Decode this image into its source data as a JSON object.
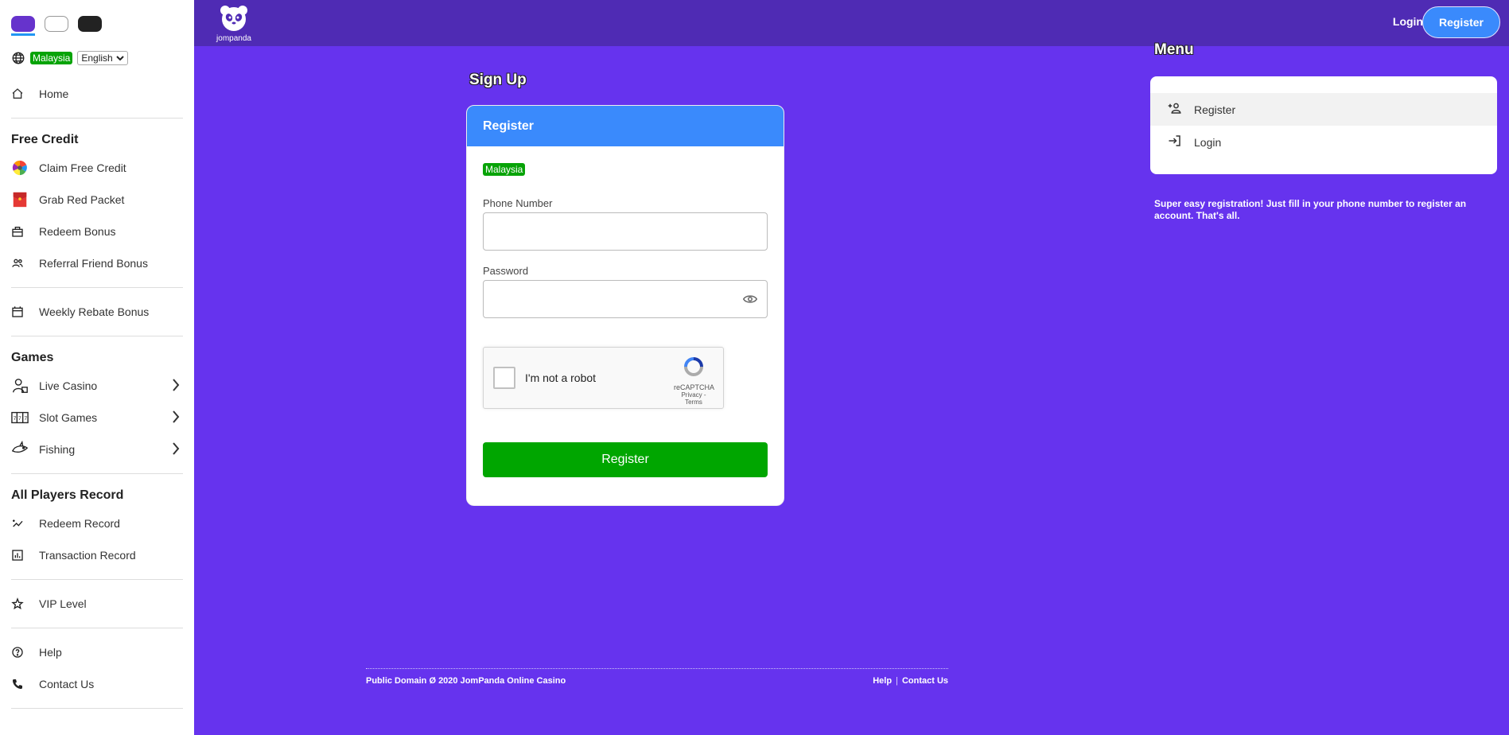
{
  "sidebar": {
    "themes": [
      {
        "name": "purple",
        "active": true
      },
      {
        "name": "white",
        "active": false
      },
      {
        "name": "dark",
        "active": false
      }
    ],
    "region_badge": "Malaysia",
    "language": "English",
    "home": "Home",
    "free_credit": {
      "title": "Free Credit",
      "items": [
        "Claim Free Credit",
        "Grab Red Packet",
        "Redeem Bonus",
        "Referral Friend Bonus"
      ]
    },
    "weekly_rebate": "Weekly Rebate Bonus",
    "games": {
      "title": "Games",
      "items": [
        "Live Casino",
        "Slot Games",
        "Fishing"
      ]
    },
    "records": {
      "title": "All Players Record",
      "items": [
        "Redeem Record",
        "Transaction Record"
      ]
    },
    "vip": "VIP Level",
    "help": "Help",
    "contact": "Contact Us"
  },
  "header": {
    "logo_text": "jompanda",
    "login": "Login",
    "register": "Register"
  },
  "signup": {
    "page_title": "Sign Up",
    "card_title": "Register",
    "region_badge": "Malaysia",
    "phone_label": "Phone Number",
    "phone_value": "",
    "password_label": "Password",
    "password_value": "",
    "recaptcha_label": "I'm not a robot",
    "recaptcha_brand": "reCAPTCHA",
    "recaptcha_links": "Privacy - Terms",
    "submit": "Register"
  },
  "menu": {
    "title": "Menu",
    "items": [
      "Register",
      "Login"
    ],
    "active": "Register",
    "promo": "Super easy registration! Just fill in your phone number to register an account. That's all."
  },
  "footer": {
    "copyright": "Public Domain Ø 2020 JomPanda Online Casino",
    "help": "Help",
    "contact": "Contact Us"
  },
  "colors": {
    "background": "#6633ee",
    "header": "#4f2bb4",
    "accent_blue": "#3a8afc",
    "success_green": "#00a600"
  }
}
